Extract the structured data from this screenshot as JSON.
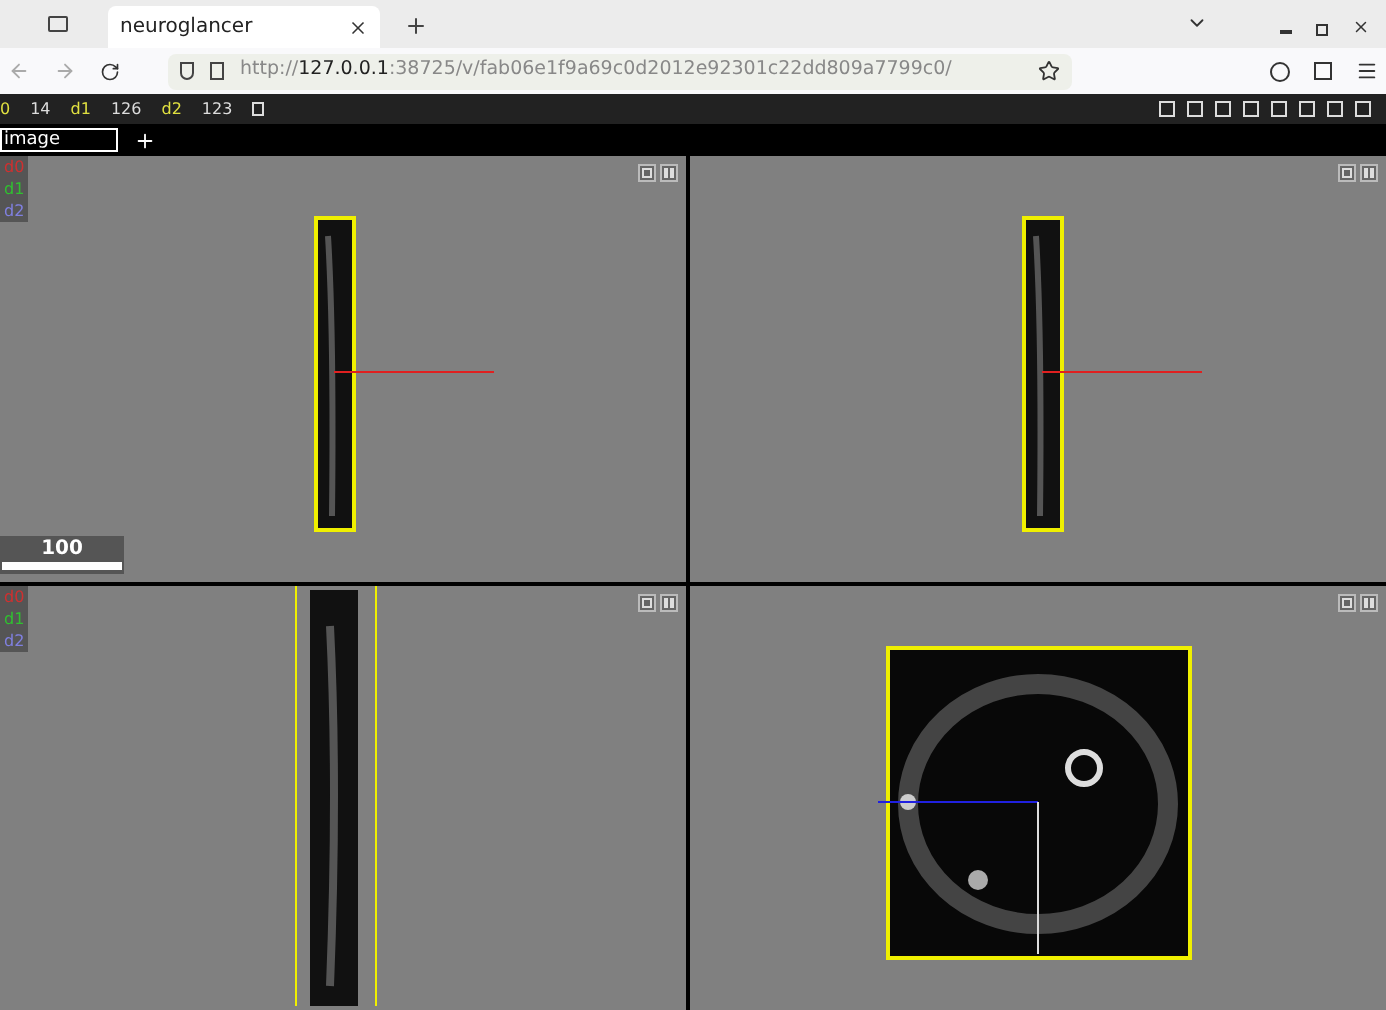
{
  "browser": {
    "tab_title": "neuroglancer",
    "url_scheme": "http://",
    "url_host": "127.0.0.1",
    "url_path": ":38725/v/fab06e1f9a69c0d2012e92301c22dd809a7799c0/"
  },
  "position": [
    {
      "label": "0",
      "value": "14"
    },
    {
      "label": "d1",
      "value": "126"
    },
    {
      "label": "d2",
      "value": "123"
    }
  ],
  "layers": [
    {
      "name": "image"
    }
  ],
  "panels": [
    {
      "kind": "slice",
      "axes": [
        "d0",
        "d1",
        "d2"
      ],
      "scale_label": "100"
    },
    {
      "kind": "slice"
    },
    {
      "kind": "side",
      "axes": [
        "d0",
        "d1",
        "d2"
      ]
    },
    {
      "kind": "volume"
    }
  ]
}
